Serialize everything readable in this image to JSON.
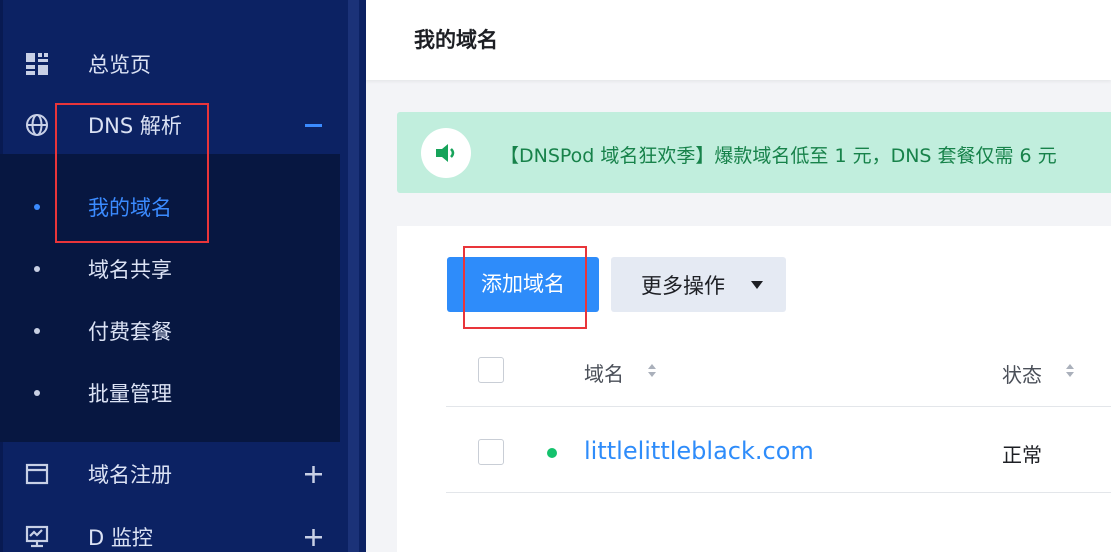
{
  "sidebar": {
    "items": [
      {
        "label": "总览页",
        "icon": "dashboard-grid-icon"
      },
      {
        "label": "DNS 解析",
        "icon": "globe-icon",
        "toggle": "−",
        "expanded": true
      },
      {
        "label": "域名注册",
        "icon": "browser-window-icon",
        "toggle": "+"
      },
      {
        "label": "D 监控",
        "icon": "monitor-icon",
        "toggle": "+"
      }
    ],
    "submenu": [
      {
        "label": "我的域名",
        "active": true
      },
      {
        "label": "域名共享"
      },
      {
        "label": "付费套餐"
      },
      {
        "label": "批量管理"
      }
    ]
  },
  "header": {
    "title": "我的域名"
  },
  "banner": {
    "icon": "speaker-icon",
    "text": "【DNSPod 域名狂欢季】爆款域名低至 1 元，DNS 套餐仅需 6 元"
  },
  "toolbar": {
    "add_label": "添加域名",
    "more_label": "更多操作"
  },
  "table": {
    "columns": [
      {
        "label": "域名",
        "sortable": true
      },
      {
        "label": "状态",
        "sortable": true
      }
    ],
    "rows": [
      {
        "domain": "littlelittleblack.com",
        "status": "正常"
      }
    ]
  },
  "colors": {
    "sidebar_bg": "#0c2263",
    "submenu_bg": "#071741",
    "accent": "#2e8cfa",
    "banner_bg": "#c1eedd",
    "banner_text": "#17824a",
    "status_ok": "#14c26d",
    "highlight_box": "#e9353a"
  }
}
